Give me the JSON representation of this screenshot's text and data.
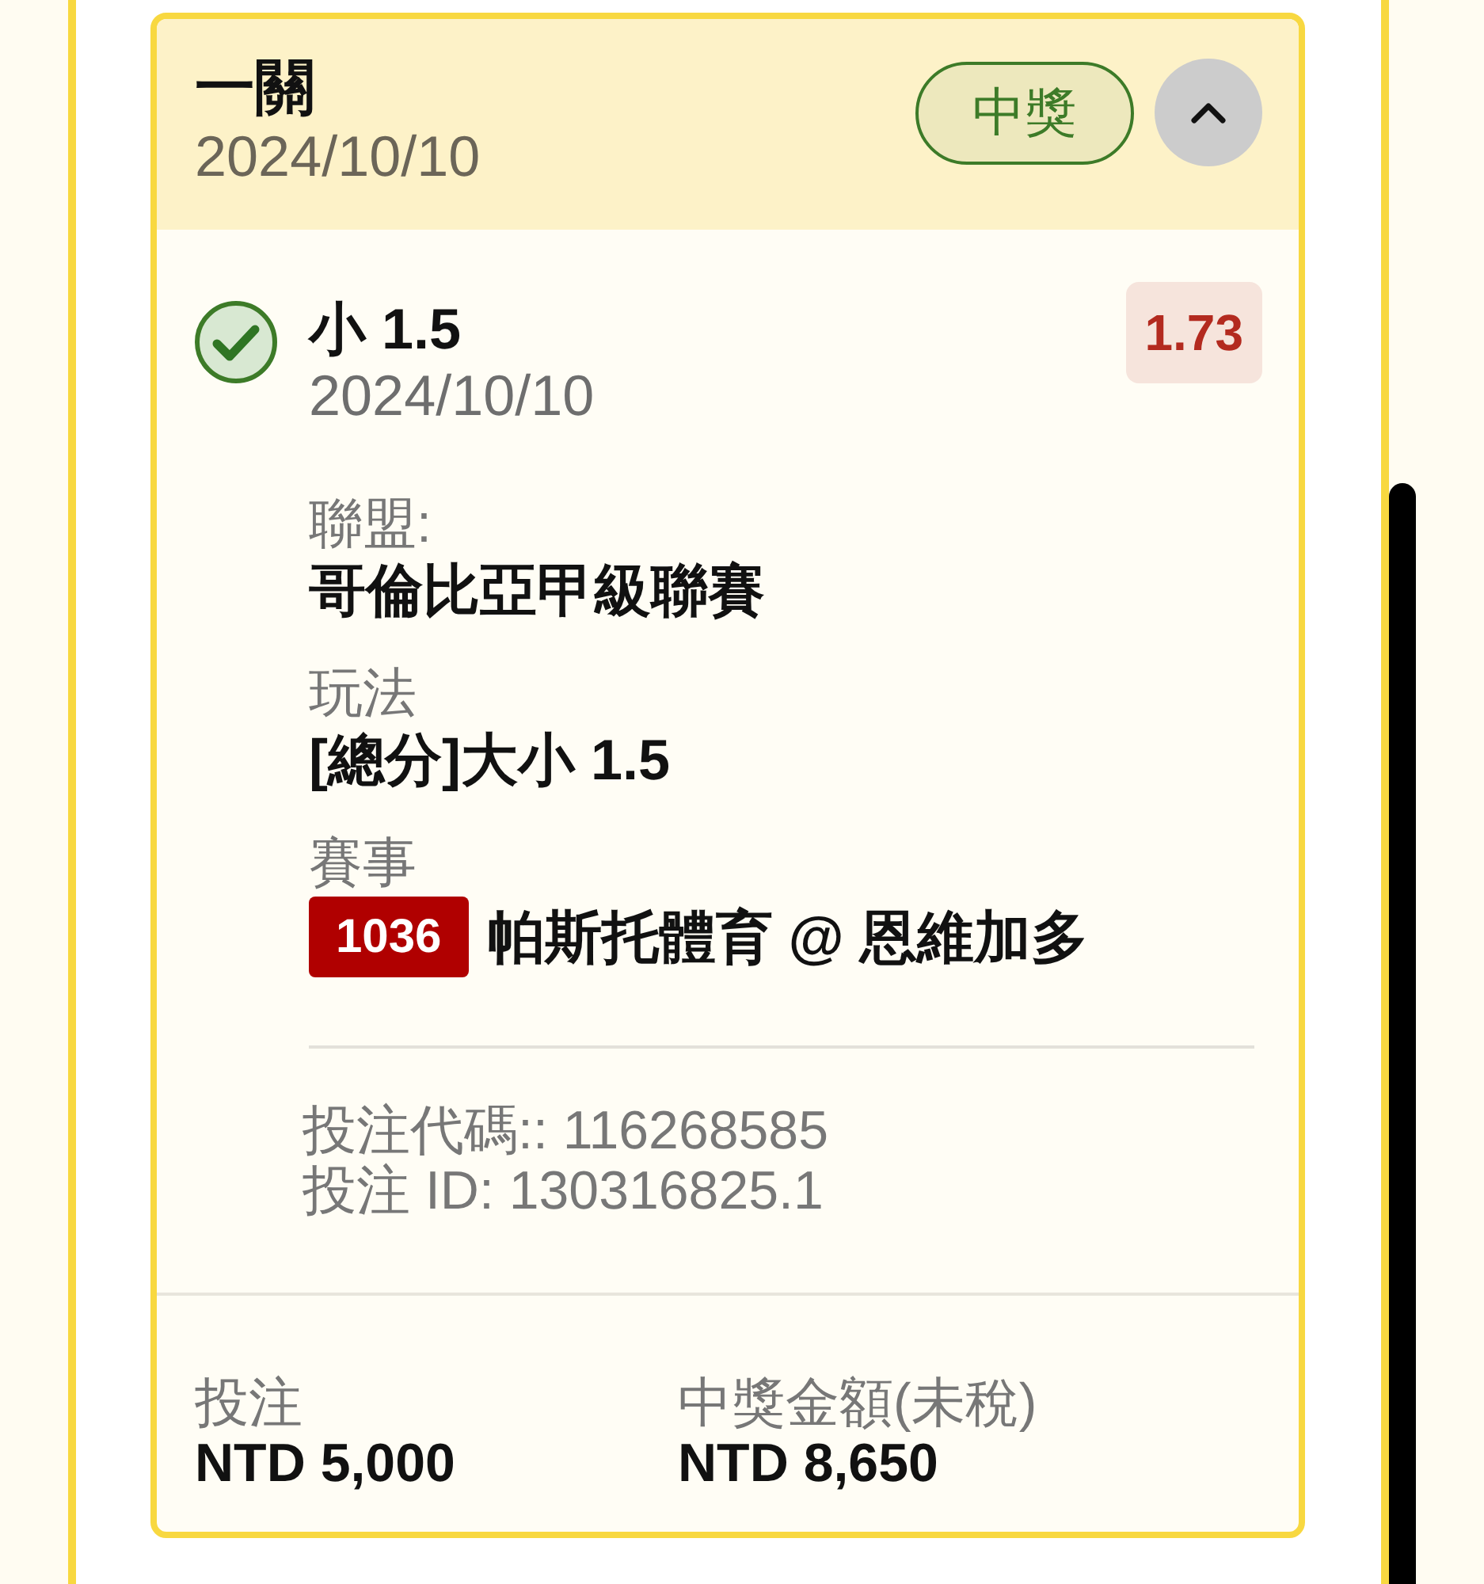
{
  "header": {
    "title": "一關",
    "date": "2024/10/10",
    "status_badge": "中獎",
    "expanded": true
  },
  "selection": {
    "won": true,
    "name": "小 1.5",
    "date": "2024/10/10",
    "odds": "1.73"
  },
  "details": [
    {
      "kind": "text",
      "label": "聯盟:",
      "value": "哥倫比亞甲級聯賽"
    },
    {
      "kind": "text",
      "label": "玩法",
      "value": "[總分]大小 1.5"
    },
    {
      "kind": "match",
      "label": "賽事",
      "match_code": "1036",
      "value": "帕斯托體育 @ 恩維加多"
    }
  ],
  "bet_refs": [
    "投注代碼:: 116268585",
    "投注 ID: 130316825.1"
  ],
  "totals": [
    {
      "label": "投注",
      "value": "NTD 5,000"
    },
    {
      "label": "中獎金額(未稅)",
      "value": "NTD 8,650"
    }
  ]
}
